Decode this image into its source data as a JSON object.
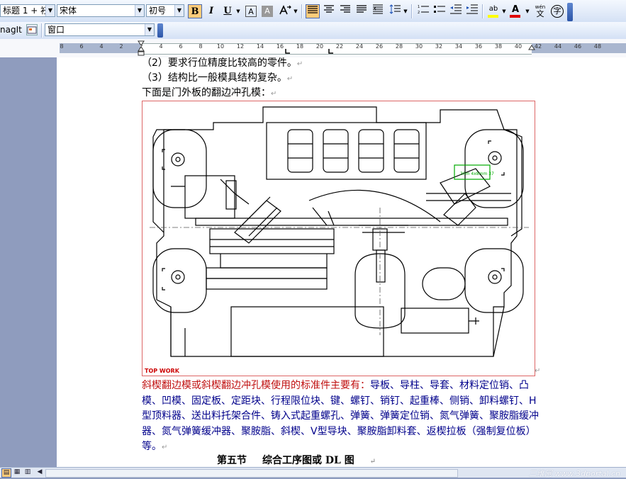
{
  "toolbar": {
    "style_value": "标题 1 + 衽",
    "font_value": "宋体",
    "size_value": "初号",
    "bold_label": "B",
    "italic_label": "I",
    "underline_label": "U",
    "char_border_label": "A",
    "char_shading_label": "A",
    "highlight_label": "ab",
    "font_color_label": "A",
    "pinyin_label": "wén",
    "enclose_label": "字",
    "accent_color": "#ffcc7a"
  },
  "toolbar2": {
    "snagit_label": "nagIt",
    "window_value": "窗口"
  },
  "ruler": {
    "labels": [
      "8",
      "6",
      "4",
      "2",
      "2",
      "4",
      "6",
      "8",
      "10",
      "12",
      "14",
      "16",
      "18",
      "20",
      "22",
      "24",
      "26",
      "28",
      "30",
      "32",
      "34",
      "36",
      "38",
      "40",
      "42",
      "44",
      "46",
      "48"
    ]
  },
  "document": {
    "line1": "（2）要求行位精度比较高的零件。",
    "line2": "（3）结构比一般模具结构复杂。",
    "line3": "下面是门外板的翻边冲孔模：",
    "para_red": "斜楔翻边模或斜楔翻边冲孔模使用的标准件主要有：",
    "para_blue": "导板、导柱、导套、材料定位销、凸模、凹模、固定板、定距块、行程限位块、键、螺钉、销钉、起重棒、侧销、卸料螺钉、H型顶料器、送出料托架合件、铸入式起重螺孔、弹簧、弹簧定位销、氮气弹簧、聚胺脂缓冲器、氮气弹簧缓冲器、聚胺脂、斜楔、V型导块、聚胺脂卸料套、返楔拉板（强制复位板）等。",
    "heading_section": "第五节",
    "heading_title": "综合工序图或 DL 图",
    "figure_caption": "TOP WORK",
    "figure_annotation": "30m 4x8mm 37"
  },
  "statusbar": {
    "watermark": "三维网 www.3dportal.cn"
  }
}
